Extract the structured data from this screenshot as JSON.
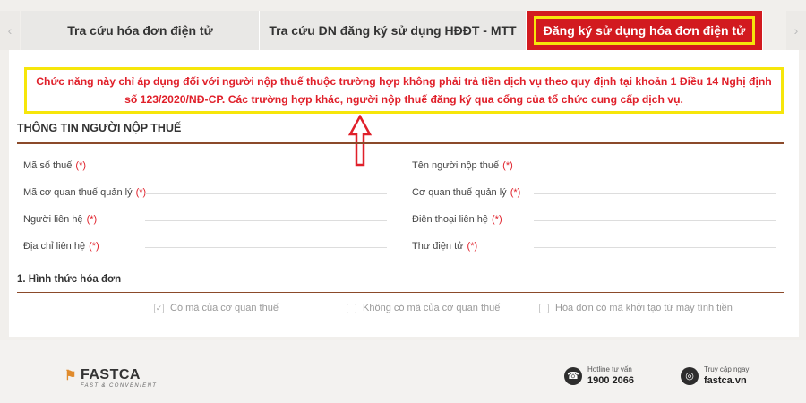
{
  "tabs": {
    "prev_icon": "‹",
    "next_icon": "›",
    "items": [
      {
        "label": "Tra cứu hóa đơn điện tử"
      },
      {
        "label": "Tra cứu DN đăng ký sử dụng HĐĐT - MTT"
      },
      {
        "label": "Đăng ký sử dụng hóa đơn điện tử"
      }
    ]
  },
  "notice": {
    "text": "Chức năng này chỉ áp dụng đối với người nộp thuế thuộc trường hợp không phải trả tiền dịch vụ theo quy định tại khoản 1 Điều 14 Nghị định số 123/2020/NĐ-CP. Các trường hợp khác, người nộp thuế đăng ký qua cổng của tổ chức cung cấp dịch vụ."
  },
  "section_taxpayer": {
    "title": "THÔNG TIN NGƯỜI NỘP THUẾ",
    "required_mark": "(*)",
    "fields": [
      {
        "label": "Mã số thuế"
      },
      {
        "label": "Tên người nộp thuế"
      },
      {
        "label": "Mã cơ quan thuế quản lý"
      },
      {
        "label": "Cơ quan thuế quản lý"
      },
      {
        "label": "Người liên hệ"
      },
      {
        "label": "Điện thoại liên hệ"
      },
      {
        "label": "Địa chỉ liên hệ"
      },
      {
        "label": "Thư điện tử"
      }
    ]
  },
  "section_invoice": {
    "title": "1. Hình thức hóa đơn",
    "options": [
      {
        "label": "Có mã của cơ quan thuế",
        "checked": true
      },
      {
        "label": "Không có mã của cơ quan thuế",
        "checked": false
      },
      {
        "label": "Hóa đơn có mã khởi tạo từ máy tính tiền",
        "checked": false
      }
    ]
  },
  "footer": {
    "logo_text": "FASTCA",
    "logo_tagline": "FAST & CONVENIENT",
    "hotline_label": "Hotline tư vấn",
    "hotline_number": "1900 2066",
    "website_label": "Truy cập ngay",
    "website": "fastca.vn"
  },
  "colors": {
    "accent_red": "#d21a1f",
    "highlight_yellow": "#f6e60b",
    "rule_brown": "#8b4a2a"
  }
}
